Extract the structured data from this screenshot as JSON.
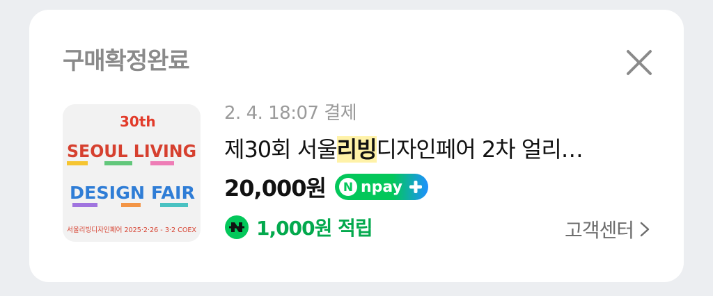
{
  "card": {
    "title": "구매확정완료",
    "close_icon": "close-icon"
  },
  "order": {
    "date": "2. 4. 18:07 결제",
    "product_title_pre": "제30회 서울",
    "product_title_highlight": "리빙",
    "product_title_post": "디자인페어 2차 얼리…",
    "price": "20,000원",
    "payment_badge": "npay",
    "reward": "1,000원 적립",
    "reward_icon": "naver-n-coin-icon"
  },
  "thumbnail": {
    "edition": "30th",
    "line1": "SEOUL LIVING",
    "line2": "DESIGN FAIR",
    "footer": "서울리빙디자인페어 2025·2·26 - 3·2 COEX"
  },
  "support": {
    "label": "고객센터",
    "icon": "chevron-right-icon"
  },
  "colors": {
    "background": "#eceef1",
    "card": "#ffffff",
    "reward_green": "#03a94d",
    "highlight": "#fff2a8",
    "npay_green": "#03c75a",
    "npay_blue": "#1e90ff"
  }
}
